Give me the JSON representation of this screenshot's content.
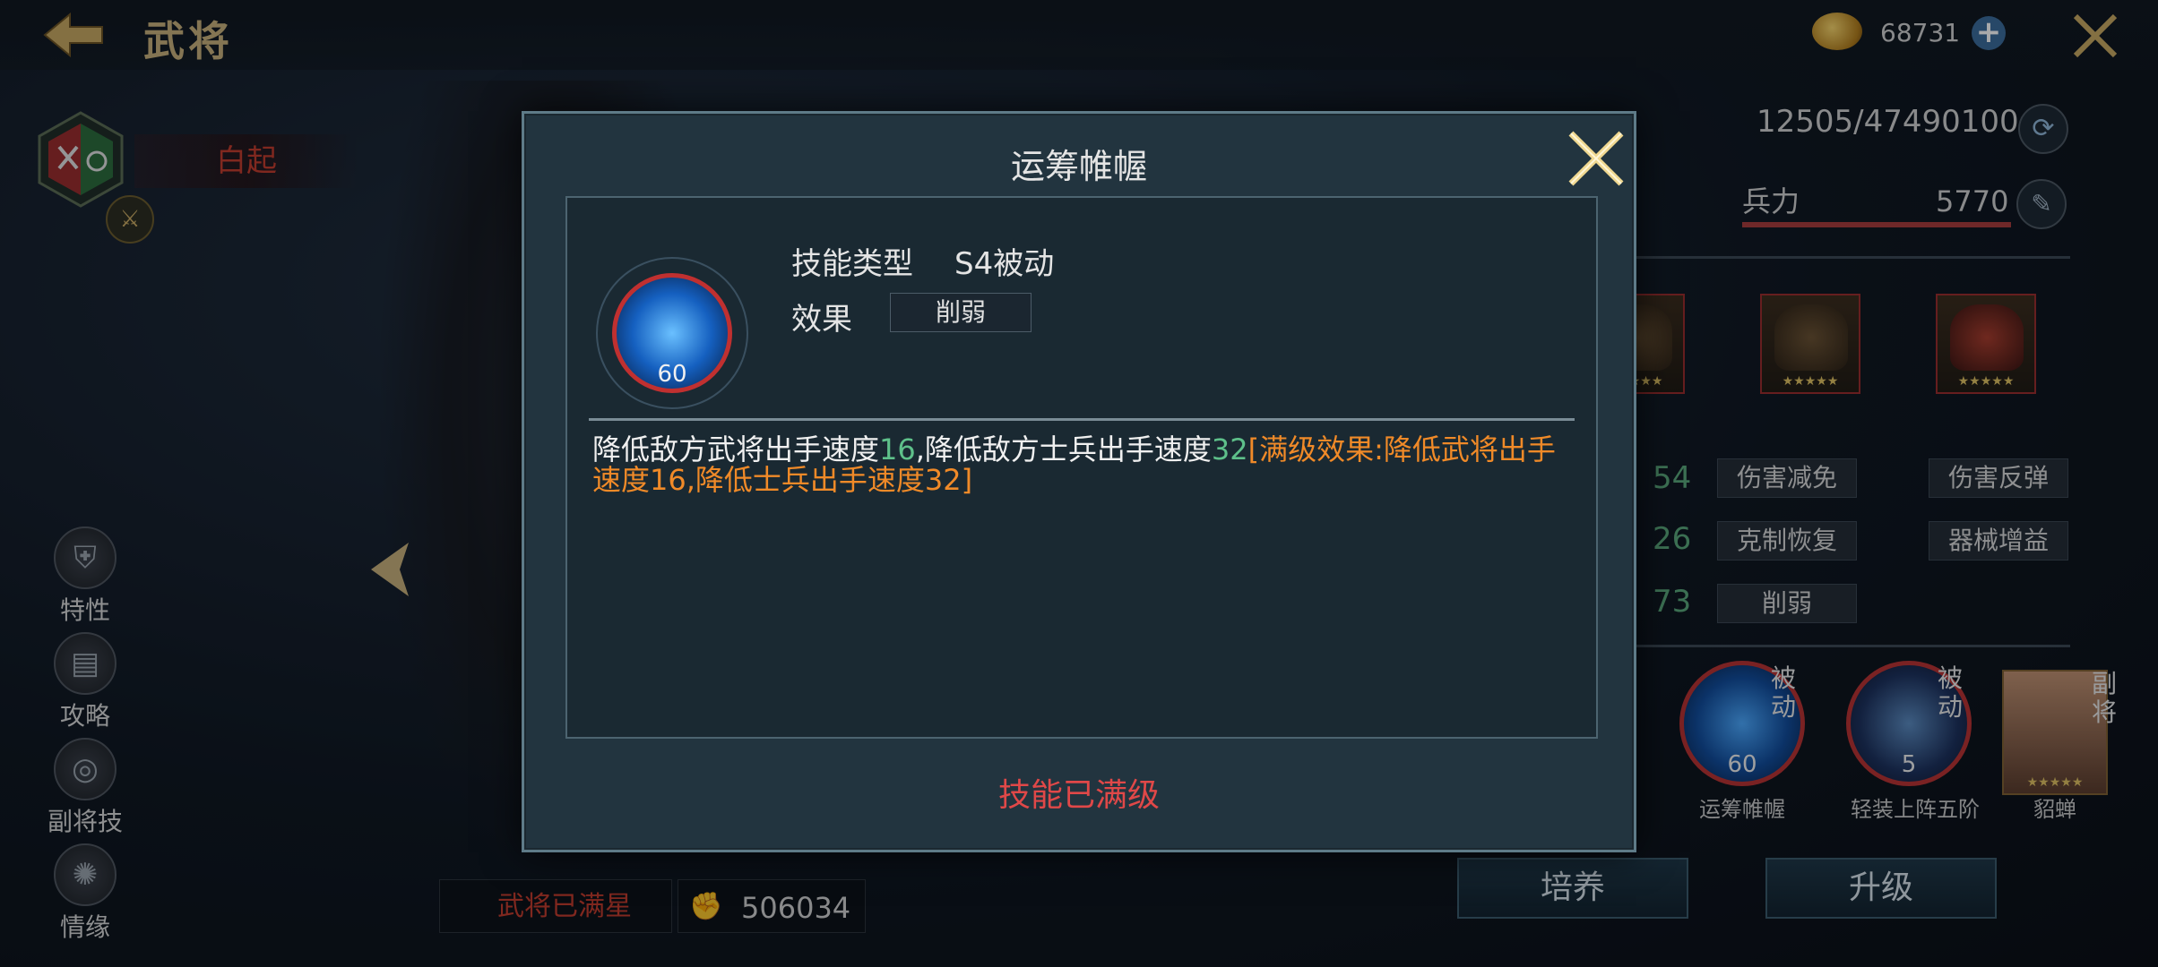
{
  "header": {
    "title": "武将",
    "coins": "68731"
  },
  "hero": {
    "name": "白起",
    "star_status": "武将已满星",
    "power": "506034"
  },
  "side_menu": [
    {
      "label": "特性",
      "icon": "trait-icon"
    },
    {
      "label": "攻略",
      "icon": "guide-icon"
    },
    {
      "label": "副将技",
      "icon": "vice-skill-icon"
    },
    {
      "label": "情缘",
      "icon": "bond-icon"
    }
  ],
  "stats": {
    "exp": "12505/47490100",
    "troop_label": "兵力",
    "troop_value": "5770",
    "values": [
      "54",
      "26",
      "73"
    ]
  },
  "effect_tags": [
    "伤害减免",
    "伤害反弹",
    "克制恢复",
    "器械增益",
    "削弱"
  ],
  "skills": [
    {
      "name": "运筹帷幄",
      "level": "60",
      "tag": "被动"
    },
    {
      "name": "轻装上阵五阶",
      "level": "5",
      "tag": "被动"
    },
    {
      "name": "貂蝉",
      "tag": "副将"
    }
  ],
  "buttons": {
    "train": "培养",
    "upgrade": "升级"
  },
  "modal": {
    "title": "运筹帷幄",
    "skill_level": "60",
    "type_label": "技能类型",
    "type_value": "S4被动",
    "effect_label": "效果",
    "effect_value": "削弱",
    "desc": {
      "p1": "降低敌方武将出手速度",
      "n1": "16",
      "p2": ",降低敌方士兵出手速度",
      "n2": "32",
      "full": "[满级效果:降低武将出手速度16,降低士兵出手速度32]"
    },
    "status": "技能已满级"
  },
  "colors": {
    "accent_red": "#e04848",
    "green": "#5ec08a",
    "orange": "#f08a28",
    "gold": "#c8b07a"
  }
}
